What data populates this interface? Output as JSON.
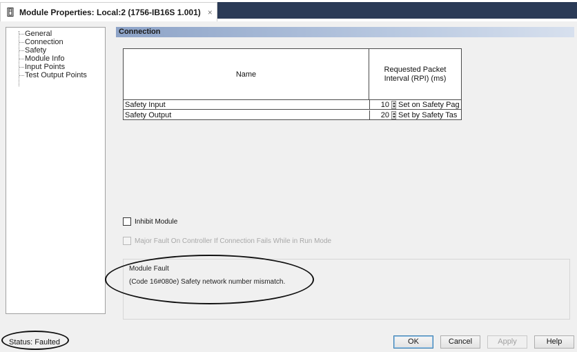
{
  "window": {
    "title": "Module Properties: Local:2 (1756-IB16S 1.001)",
    "close_glyph": "×",
    "icon": "module-icon"
  },
  "sidebar": {
    "items": [
      {
        "label": "General"
      },
      {
        "label": "Connection"
      },
      {
        "label": "Safety"
      },
      {
        "label": "Module Info"
      },
      {
        "label": "Input Points"
      },
      {
        "label": "Test Output Points"
      }
    ],
    "selected": "Connection"
  },
  "section": {
    "title": "Connection"
  },
  "table": {
    "headers": {
      "name": "Name",
      "rpi": "Requested Packet Interval (RPI) (ms)"
    },
    "rows": [
      {
        "name": "Safety Input",
        "rpi": "10",
        "note": "Set on Safety Pag"
      },
      {
        "name": "Safety Output",
        "rpi": "20",
        "note": "Set by Safety Tas"
      }
    ]
  },
  "options": {
    "inhibit_module": {
      "label": "Inhibit Module",
      "checked": false
    },
    "major_fault": {
      "label": "Major Fault On Controller If Connection Fails While in Run Mode",
      "checked": false,
      "enabled": false
    }
  },
  "fault": {
    "title": "Module Fault",
    "message": "(Code 16#080e) Safety network number mismatch."
  },
  "status": {
    "text": "Status:  Faulted"
  },
  "buttons": {
    "ok": "OK",
    "cancel": "Cancel",
    "apply": "Apply",
    "help": "Help"
  },
  "colors": {
    "title_strip": "#2a3a56",
    "header_bar": "#8da3c7",
    "dialog_bg": "#f0f0f0"
  }
}
